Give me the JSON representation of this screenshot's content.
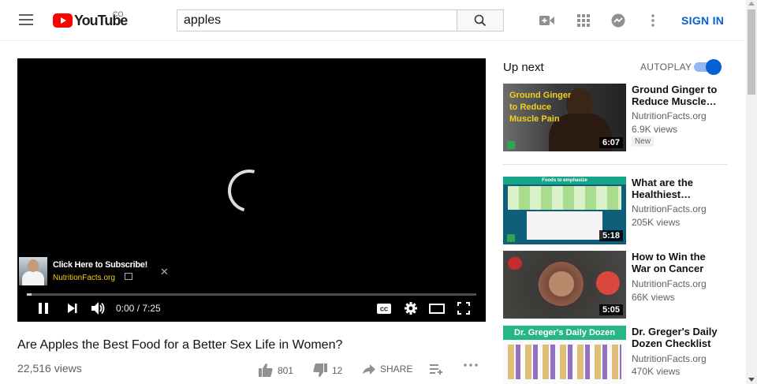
{
  "header": {
    "logo_text": "YouTube",
    "logo_country": "CO",
    "search_value": "apples",
    "sign_in_label": "SIGN IN"
  },
  "player": {
    "subscribe_title": "Click Here to Subscribe!",
    "subscribe_channel": "NutritionFacts.org",
    "time_display": "0:00 / 7:25",
    "progress_fraction": 0.01
  },
  "video": {
    "title": "Are Apples the Best Food for a Better Sex Life in Women?",
    "views": "22,516 views",
    "likes": "801",
    "dislikes": "12",
    "share_label": "SHARE"
  },
  "sidebar": {
    "up_next_label": "Up next",
    "autoplay_label": "AUTOPLAY",
    "autoplay_on": true,
    "items": [
      {
        "title": "Ground Ginger to Reduce Muscle…",
        "channel": "NutritionFacts.org",
        "views": "6.9K views",
        "duration": "6:07",
        "badge": "New",
        "thumb_text": "Ground Ginger to Reduce Muscle Pain"
      },
      {
        "title": "What are the Healthiest…",
        "channel": "NutritionFacts.org",
        "views": "205K views",
        "duration": "5:18",
        "thumb_text": "Foods to emphasize"
      },
      {
        "title": "How to Win the War on Cancer",
        "channel": "NutritionFacts.org",
        "views": "66K views",
        "duration": "5:05"
      },
      {
        "title": "Dr. Greger's Daily Dozen Checklist",
        "channel": "NutritionFacts.org",
        "views": "470K views",
        "thumb_text": "Dr. Greger's Daily Dozen"
      }
    ]
  },
  "colors": {
    "brand_red": "#ff0000",
    "link_blue": "#065fd4",
    "subscribe_channel_yellow": "#f2d01c"
  },
  "icons": [
    "menu-icon",
    "youtube-logo-icon",
    "search-icon",
    "video-camera-icon",
    "apps-grid-icon",
    "messages-icon",
    "more-vert-icon",
    "pause-icon",
    "next-icon",
    "volume-icon",
    "captions-icon",
    "settings-icon",
    "theater-mode-icon",
    "fullscreen-icon",
    "thumb-up-icon",
    "thumb-down-icon",
    "share-icon",
    "add-to-playlist-icon",
    "more-horiz-icon"
  ]
}
